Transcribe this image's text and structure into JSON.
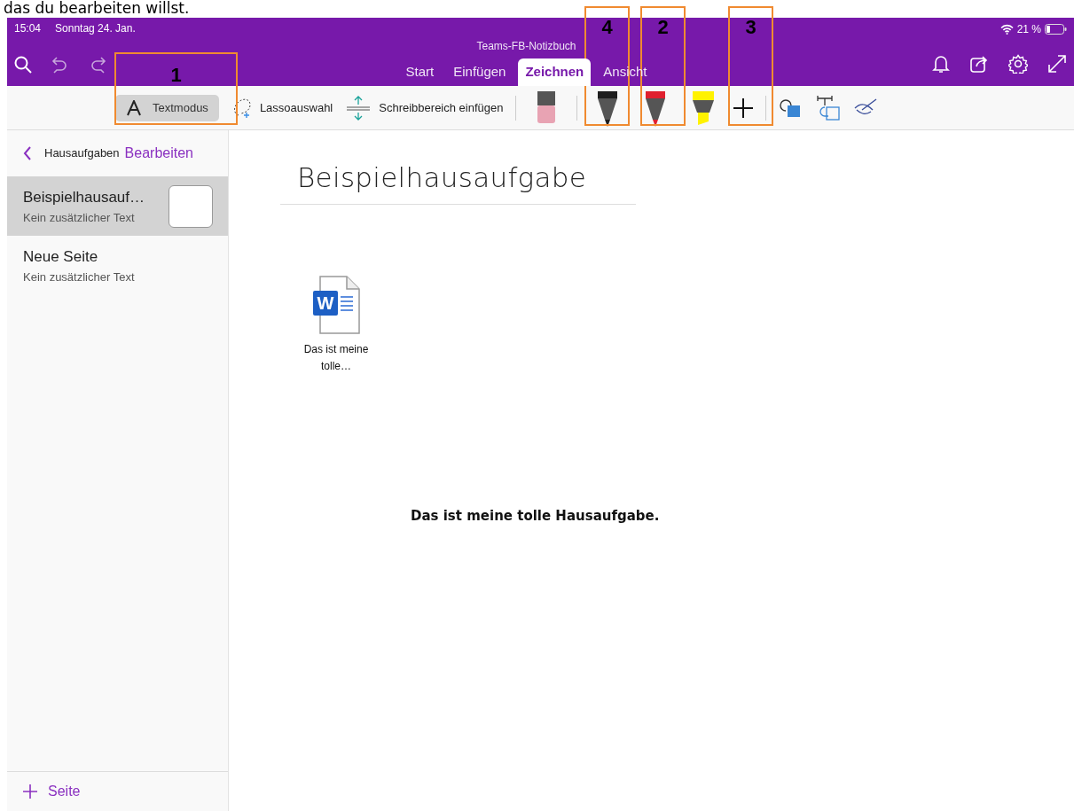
{
  "doc_text": "das du bearbeiten willst.",
  "status": {
    "time": "15:04",
    "date": "Sonntag 24. Jan.",
    "battery": "21 %"
  },
  "notebook_title": "Teams-FB-Notizbuch",
  "tabs": [
    {
      "label": "Start",
      "selected": false
    },
    {
      "label": "Einfügen",
      "selected": false
    },
    {
      "label": "Zeichnen",
      "selected": true
    },
    {
      "label": "Ansicht",
      "selected": false
    }
  ],
  "toolbar": {
    "text_mode": {
      "label": "Textmodus",
      "selected": true
    },
    "lasso": "Lassoauswahl",
    "insert_space": "Schreibbereich einfügen"
  },
  "pens": [
    {
      "kind": "eraser",
      "color": "#e8a3b3"
    },
    {
      "kind": "pen",
      "color": "#1e1e1e"
    },
    {
      "kind": "pen",
      "color": "#e0202e"
    },
    {
      "kind": "highlighter",
      "color": "#fff200"
    }
  ],
  "sidebar": {
    "back_label": "Hausaufgaben",
    "edit_label": "Bearbeiten",
    "pages": [
      {
        "title": "Beispielhausauf…",
        "subtitle": "Kein zusätzlicher Text",
        "selected": true,
        "thumbnail": true
      },
      {
        "title": "Neue Seite",
        "subtitle": "Kein zusätzlicher Text",
        "selected": false,
        "thumbnail": false
      }
    ],
    "add_label": "Seite"
  },
  "page": {
    "title": "Beispielhausaufgabe",
    "attachment": {
      "icon_letter": "W",
      "caption": "Das ist meine tolle…"
    },
    "body": "Das ist meine tolle Hausaufgabe."
  },
  "annotations": [
    {
      "number": "1"
    },
    {
      "number": "4"
    },
    {
      "number": "2"
    },
    {
      "number": "3"
    }
  ]
}
